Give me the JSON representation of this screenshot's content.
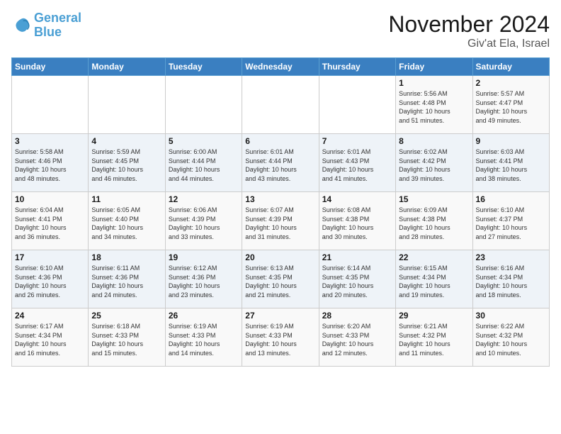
{
  "logo": {
    "line1": "General",
    "line2": "Blue"
  },
  "header": {
    "month": "November 2024",
    "location": "Giv'at Ela, Israel"
  },
  "weekdays": [
    "Sunday",
    "Monday",
    "Tuesday",
    "Wednesday",
    "Thursday",
    "Friday",
    "Saturday"
  ],
  "weeks": [
    [
      {
        "day": "",
        "info": ""
      },
      {
        "day": "",
        "info": ""
      },
      {
        "day": "",
        "info": ""
      },
      {
        "day": "",
        "info": ""
      },
      {
        "day": "",
        "info": ""
      },
      {
        "day": "1",
        "info": "Sunrise: 5:56 AM\nSunset: 4:48 PM\nDaylight: 10 hours\nand 51 minutes."
      },
      {
        "day": "2",
        "info": "Sunrise: 5:57 AM\nSunset: 4:47 PM\nDaylight: 10 hours\nand 49 minutes."
      }
    ],
    [
      {
        "day": "3",
        "info": "Sunrise: 5:58 AM\nSunset: 4:46 PM\nDaylight: 10 hours\nand 48 minutes."
      },
      {
        "day": "4",
        "info": "Sunrise: 5:59 AM\nSunset: 4:45 PM\nDaylight: 10 hours\nand 46 minutes."
      },
      {
        "day": "5",
        "info": "Sunrise: 6:00 AM\nSunset: 4:44 PM\nDaylight: 10 hours\nand 44 minutes."
      },
      {
        "day": "6",
        "info": "Sunrise: 6:01 AM\nSunset: 4:44 PM\nDaylight: 10 hours\nand 43 minutes."
      },
      {
        "day": "7",
        "info": "Sunrise: 6:01 AM\nSunset: 4:43 PM\nDaylight: 10 hours\nand 41 minutes."
      },
      {
        "day": "8",
        "info": "Sunrise: 6:02 AM\nSunset: 4:42 PM\nDaylight: 10 hours\nand 39 minutes."
      },
      {
        "day": "9",
        "info": "Sunrise: 6:03 AM\nSunset: 4:41 PM\nDaylight: 10 hours\nand 38 minutes."
      }
    ],
    [
      {
        "day": "10",
        "info": "Sunrise: 6:04 AM\nSunset: 4:41 PM\nDaylight: 10 hours\nand 36 minutes."
      },
      {
        "day": "11",
        "info": "Sunrise: 6:05 AM\nSunset: 4:40 PM\nDaylight: 10 hours\nand 34 minutes."
      },
      {
        "day": "12",
        "info": "Sunrise: 6:06 AM\nSunset: 4:39 PM\nDaylight: 10 hours\nand 33 minutes."
      },
      {
        "day": "13",
        "info": "Sunrise: 6:07 AM\nSunset: 4:39 PM\nDaylight: 10 hours\nand 31 minutes."
      },
      {
        "day": "14",
        "info": "Sunrise: 6:08 AM\nSunset: 4:38 PM\nDaylight: 10 hours\nand 30 minutes."
      },
      {
        "day": "15",
        "info": "Sunrise: 6:09 AM\nSunset: 4:38 PM\nDaylight: 10 hours\nand 28 minutes."
      },
      {
        "day": "16",
        "info": "Sunrise: 6:10 AM\nSunset: 4:37 PM\nDaylight: 10 hours\nand 27 minutes."
      }
    ],
    [
      {
        "day": "17",
        "info": "Sunrise: 6:10 AM\nSunset: 4:36 PM\nDaylight: 10 hours\nand 26 minutes."
      },
      {
        "day": "18",
        "info": "Sunrise: 6:11 AM\nSunset: 4:36 PM\nDaylight: 10 hours\nand 24 minutes."
      },
      {
        "day": "19",
        "info": "Sunrise: 6:12 AM\nSunset: 4:36 PM\nDaylight: 10 hours\nand 23 minutes."
      },
      {
        "day": "20",
        "info": "Sunrise: 6:13 AM\nSunset: 4:35 PM\nDaylight: 10 hours\nand 21 minutes."
      },
      {
        "day": "21",
        "info": "Sunrise: 6:14 AM\nSunset: 4:35 PM\nDaylight: 10 hours\nand 20 minutes."
      },
      {
        "day": "22",
        "info": "Sunrise: 6:15 AM\nSunset: 4:34 PM\nDaylight: 10 hours\nand 19 minutes."
      },
      {
        "day": "23",
        "info": "Sunrise: 6:16 AM\nSunset: 4:34 PM\nDaylight: 10 hours\nand 18 minutes."
      }
    ],
    [
      {
        "day": "24",
        "info": "Sunrise: 6:17 AM\nSunset: 4:34 PM\nDaylight: 10 hours\nand 16 minutes."
      },
      {
        "day": "25",
        "info": "Sunrise: 6:18 AM\nSunset: 4:33 PM\nDaylight: 10 hours\nand 15 minutes."
      },
      {
        "day": "26",
        "info": "Sunrise: 6:19 AM\nSunset: 4:33 PM\nDaylight: 10 hours\nand 14 minutes."
      },
      {
        "day": "27",
        "info": "Sunrise: 6:19 AM\nSunset: 4:33 PM\nDaylight: 10 hours\nand 13 minutes."
      },
      {
        "day": "28",
        "info": "Sunrise: 6:20 AM\nSunset: 4:33 PM\nDaylight: 10 hours\nand 12 minutes."
      },
      {
        "day": "29",
        "info": "Sunrise: 6:21 AM\nSunset: 4:32 PM\nDaylight: 10 hours\nand 11 minutes."
      },
      {
        "day": "30",
        "info": "Sunrise: 6:22 AM\nSunset: 4:32 PM\nDaylight: 10 hours\nand 10 minutes."
      }
    ]
  ]
}
